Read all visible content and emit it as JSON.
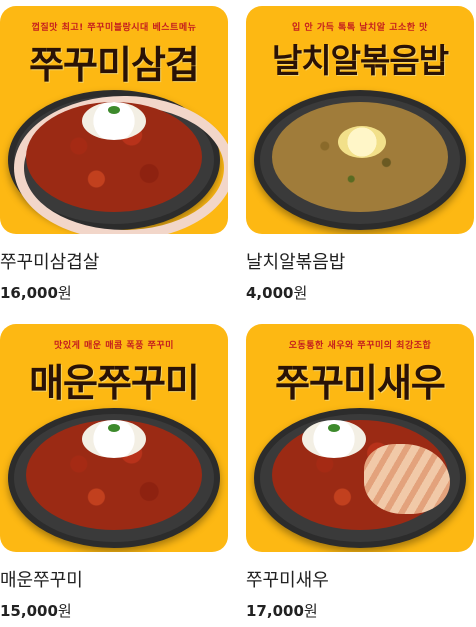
{
  "colors": {
    "thumb_bg": "#FDB813",
    "headline": "#2a1206",
    "banner": "#c41e1e"
  },
  "menu": [
    {
      "name": "쭈꾸미삼겹살",
      "price": "16,000",
      "unit": "원",
      "image": {
        "banner": "껍질맛 최고! 쭈꾸미블랑시대 베스트메뉴",
        "headline": "쭈꾸미삼겹"
      }
    },
    {
      "name": "날치알볶음밥",
      "price": "4,000",
      "unit": "원",
      "image": {
        "banner": "입 안 가득 톡톡 날치알 고소한 맛",
        "headline": "날치알볶음밥"
      }
    },
    {
      "name": "매운쭈꾸미",
      "price": "15,000",
      "unit": "원",
      "image": {
        "banner": "맛있게 매운 매콤 폭풍 쭈꾸미",
        "headline": "매운쭈꾸미"
      }
    },
    {
      "name": "쭈꾸미새우",
      "price": "17,000",
      "unit": "원",
      "image": {
        "banner": "오동통한 새우와 쭈꾸미의 최강조합",
        "headline": "쭈꾸미새우"
      }
    }
  ]
}
